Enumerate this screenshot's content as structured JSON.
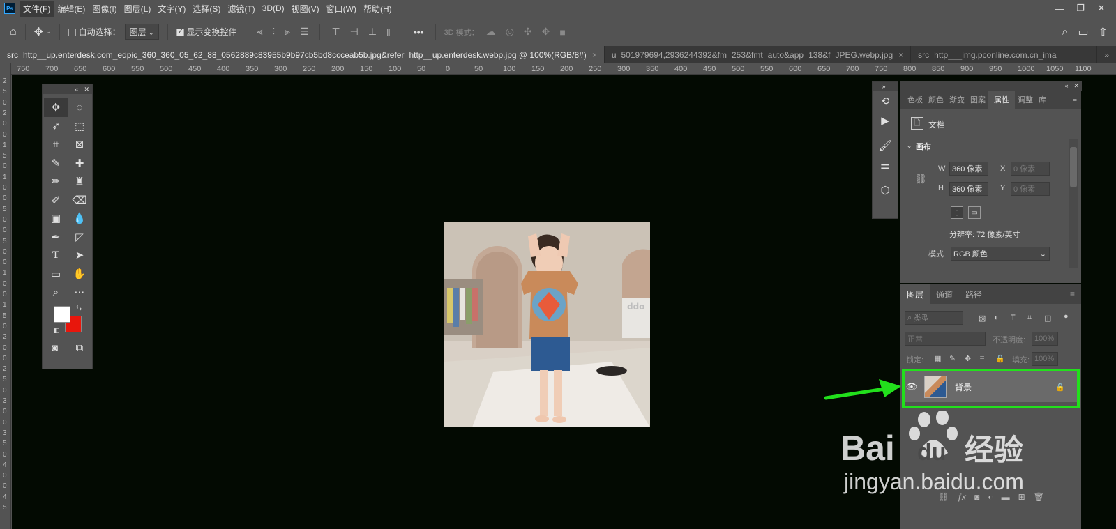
{
  "menubar": {
    "logo": "Ps",
    "items": [
      "文件(F)",
      "编辑(E)",
      "图像(I)",
      "图层(L)",
      "文字(Y)",
      "选择(S)",
      "滤镜(T)",
      "3D(D)",
      "视图(V)",
      "窗口(W)",
      "帮助(H)"
    ],
    "window_controls": [
      "—",
      "❐",
      "✕"
    ]
  },
  "options": {
    "auto_select_label": "自动选择：",
    "auto_select_value": "图层",
    "show_transform_label": "显示变换控件",
    "mode3d_label": "3D 模式："
  },
  "tabs": [
    {
      "label": "src=http__up.enterdesk.com_edpic_360_360_05_62_88_0562889c83955b9b97cb5bd8ccceab5b.jpg&refer=http__up.enterdesk.webp.jpg @ 100%(RGB/8#)",
      "active": true
    },
    {
      "label": "u=501979694,2936244392&fm=253&fmt=auto&app=138&f=JPEG.webp.jpg",
      "active": false
    },
    {
      "label": "src=http___img.pconline.com.cn_ima",
      "active": false
    }
  ],
  "tab_close": "×",
  "tab_more": "»",
  "ruler_h": [
    "750",
    "700",
    "650",
    "600",
    "550",
    "500",
    "450",
    "400",
    "350",
    "300",
    "250",
    "200",
    "150",
    "100",
    "50",
    "0",
    "50",
    "100",
    "150",
    "200",
    "250",
    "300",
    "350",
    "400",
    "450",
    "500",
    "550",
    "600",
    "650",
    "700",
    "750",
    "800",
    "850",
    "900",
    "950",
    "1000",
    "1050",
    "1100"
  ],
  "ruler_v": [
    "2",
    "5",
    "0",
    "2",
    "0",
    "0",
    "1",
    "5",
    "0",
    "1",
    "0",
    "0",
    "5",
    "0",
    "0",
    "5",
    "0",
    "0",
    "1",
    "0",
    "0",
    "1",
    "5",
    "0",
    "2",
    "0",
    "0",
    "2",
    "5",
    "0",
    "3",
    "0",
    "0",
    "3",
    "5",
    "0",
    "4",
    "0",
    "0",
    "4",
    "5"
  ],
  "colors": {
    "foreground": "#ffffff",
    "background": "#e8160c",
    "canvas": "#030a02",
    "highlight": "#22e01c"
  },
  "properties": {
    "tabs": [
      "色板",
      "颜色",
      "渐变",
      "图案",
      "属性",
      "调整",
      "库"
    ],
    "active_tab": "属性",
    "doc_label": "文档",
    "canvas_section": "画布",
    "w_label": "W",
    "w_value": "360 像素",
    "h_label": "H",
    "h_value": "360 像素",
    "x_label": "X",
    "x_placeholder": "0 像素",
    "y_label": "Y",
    "y_placeholder": "0 像素",
    "resolution": "分辨率: 72 像素/英寸",
    "mode_label": "模式",
    "mode_value": "RGB 颜色"
  },
  "layers": {
    "tabs": [
      "图层",
      "通道",
      "路径"
    ],
    "filter_placeholder": "类型",
    "blend_mode": "正常",
    "opacity_label": "不透明度:",
    "opacity_value": "100%",
    "lock_label": "锁定:",
    "fill_label": "填充:",
    "fill_value": "100%",
    "items": [
      {
        "name": "背景",
        "visible": true,
        "locked": true
      }
    ]
  },
  "watermark": {
    "brand": "Bai",
    "brand2": "du",
    "cn": "经验",
    "url": "jingyan.baidu.com"
  }
}
